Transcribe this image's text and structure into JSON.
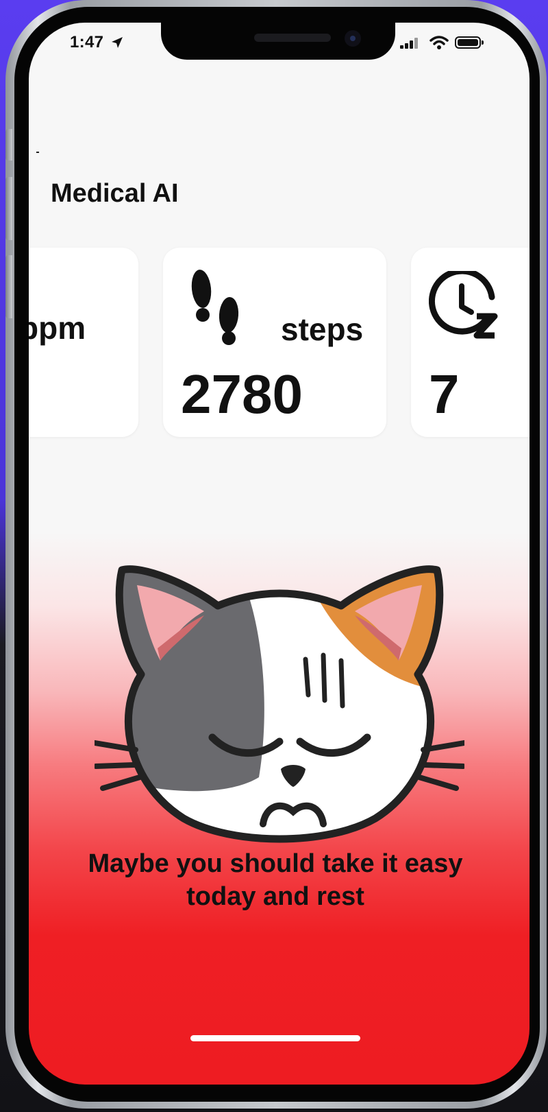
{
  "status_bar": {
    "time": "1:47",
    "location_icon": "location-arrow-icon",
    "signal_icon": "cellular-signal-icon",
    "wifi_icon": "wifi-icon",
    "battery_icon": "battery-icon"
  },
  "app": {
    "title": "Medical AI"
  },
  "cards": [
    {
      "icon": "heart-icon",
      "unit": "bpm",
      "value": ""
    },
    {
      "icon": "footprints-icon",
      "unit": "steps",
      "value": "2780"
    },
    {
      "icon": "sleep-clock-icon",
      "unit": "",
      "value": "7"
    }
  ],
  "mood": {
    "illustration": "tired-cat-face",
    "message": "Maybe you should take it easy today and rest"
  },
  "colors": {
    "background_top": "#f7f7f7",
    "background_bottom": "#ee1c22",
    "text": "#111111",
    "card": "#ffffff"
  }
}
